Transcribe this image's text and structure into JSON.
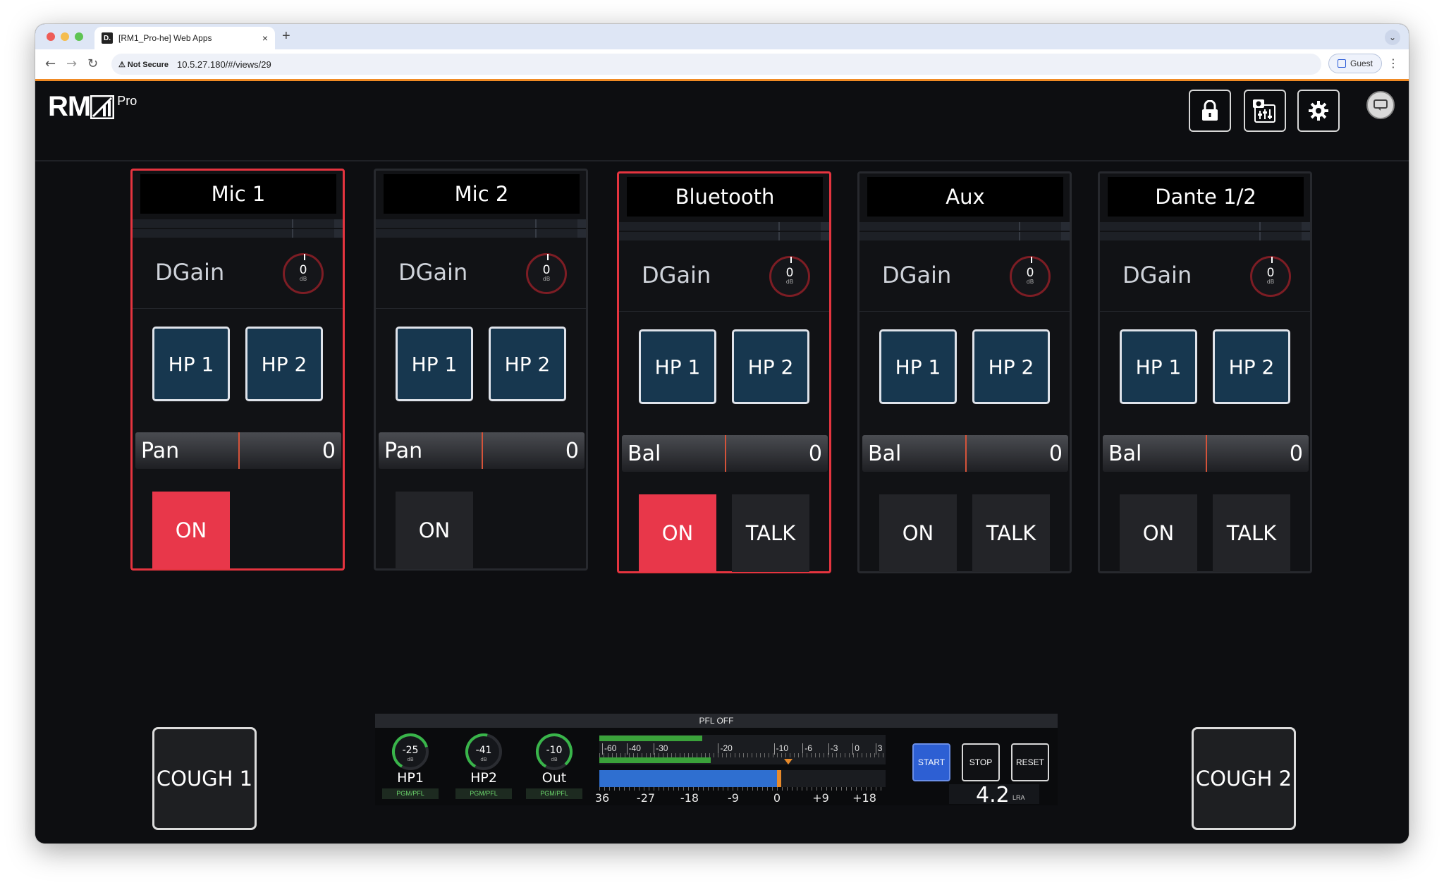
{
  "browser": {
    "tab_favicon": "D.",
    "tab_title": "[RM1_Pro-he] Web Apps",
    "tab_close": "×",
    "new_tab": "+",
    "security_label": "⚠ Not Secure",
    "url": "10.5.27.180/#/views/29",
    "guest_label": "Guest"
  },
  "app": {
    "logo_main": "RM",
    "logo_suffix": "Pro",
    "header_icons": [
      "lock-icon",
      "snapshot-mixer-icon",
      "gear-icon",
      "message-icon"
    ]
  },
  "strips": [
    {
      "name": "Mic 1",
      "dgain_label": "DGain",
      "dgain_value": "0",
      "dgain_unit": "dB",
      "hp1": "HP 1",
      "hp2": "HP 2",
      "pan_label": "Pan",
      "pan_value": "0",
      "on_label": "ON",
      "on_active": true,
      "talk_label": null,
      "selected": true
    },
    {
      "name": "Mic 2",
      "dgain_label": "DGain",
      "dgain_value": "0",
      "dgain_unit": "dB",
      "hp1": "HP 1",
      "hp2": "HP 2",
      "pan_label": "Pan",
      "pan_value": "0",
      "on_label": "ON",
      "on_active": false,
      "talk_label": null,
      "selected": false
    },
    {
      "name": "Bluetooth",
      "dgain_label": "DGain",
      "dgain_value": "0",
      "dgain_unit": "dB",
      "hp1": "HP 1",
      "hp2": "HP 2",
      "pan_label": "Bal",
      "pan_value": "0",
      "on_label": "ON",
      "on_active": true,
      "talk_label": "TALK",
      "selected": true
    },
    {
      "name": "Aux",
      "dgain_label": "DGain",
      "dgain_value": "0",
      "dgain_unit": "dB",
      "hp1": "HP 1",
      "hp2": "HP 2",
      "pan_label": "Bal",
      "pan_value": "0",
      "on_label": "ON",
      "on_active": false,
      "talk_label": "TALK",
      "selected": false
    },
    {
      "name": "Dante 1/2",
      "dgain_label": "DGain",
      "dgain_value": "0",
      "dgain_unit": "dB",
      "hp1": "HP 1",
      "hp2": "HP 2",
      "pan_label": "Bal",
      "pan_value": "0",
      "on_label": "ON",
      "on_active": false,
      "talk_label": "TALK",
      "selected": false
    }
  ],
  "cough": {
    "left": "COUGH 1",
    "right": "COUGH 2"
  },
  "monitor": {
    "pfl_status": "PFL OFF",
    "knobs": [
      {
        "value": "-25",
        "unit": "dB",
        "label": "HP1",
        "source": "PGM/PFL",
        "level": 0.62
      },
      {
        "value": "-41",
        "unit": "dB",
        "label": "HP2",
        "source": "PGM/PFL",
        "level": 0.45
      },
      {
        "value": "-10",
        "unit": "dB",
        "label": "Out",
        "source": "PGM/PFL",
        "level": 0.8
      }
    ],
    "peak_scale": [
      "-60",
      "-40",
      "-30",
      "-20",
      "-10",
      "-6",
      "-3",
      "0",
      "3"
    ],
    "peak_levels": [
      0.36,
      0.39
    ],
    "loudness_scale": [
      "36",
      "-27",
      "-18",
      "-9",
      "0",
      "+9",
      "+18"
    ],
    "loudness_level": 0.62,
    "start_label": "START",
    "stop_label": "STOP",
    "reset_label": "RESET",
    "lra_value": "4.2",
    "lra_unit": "LRA"
  },
  "colors": {
    "accent_red": "#e5343f",
    "on_red": "#e8374a",
    "hp_blue": "#17374f",
    "meter_green": "#3aa23a",
    "loudness_blue": "#2f6fd0"
  }
}
